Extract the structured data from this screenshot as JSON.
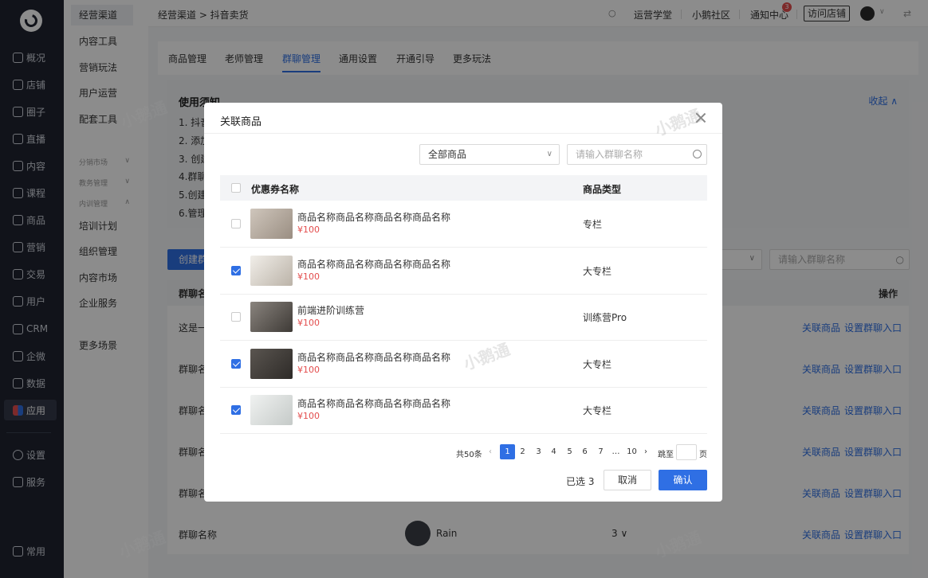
{
  "nav": {
    "items": [
      {
        "label": "概况",
        "icon": "chart-icon"
      },
      {
        "label": "店铺",
        "icon": "store-icon"
      },
      {
        "label": "圈子",
        "icon": "circle-icon"
      },
      {
        "label": "直播",
        "icon": "live-icon"
      },
      {
        "label": "内容",
        "icon": "content-icon"
      },
      {
        "label": "课程",
        "icon": "course-icon"
      },
      {
        "label": "商品",
        "icon": "goods-icon"
      },
      {
        "label": "营销",
        "icon": "marketing-icon"
      },
      {
        "label": "交易",
        "icon": "trade-icon"
      },
      {
        "label": "用户",
        "icon": "user-icon"
      },
      {
        "label": "CRM",
        "icon": "crm-icon"
      },
      {
        "label": "企微",
        "icon": "wecom-icon"
      },
      {
        "label": "数据",
        "icon": "data-icon"
      },
      {
        "label": "应用",
        "icon": "apps-icon"
      }
    ],
    "settings": "设置",
    "service": "服务",
    "common": "常用"
  },
  "side": {
    "items": [
      "经营渠道",
      "内容工具",
      "营销玩法",
      "用户运营",
      "配套工具"
    ],
    "groups": [
      "分销市场",
      "教务管理",
      "内训管理"
    ],
    "sub": [
      "培训计划",
      "组织管理",
      "内容市场",
      "企业服务"
    ],
    "more": "更多场景"
  },
  "topbar": {
    "breadcrumb": "经营渠道 > 抖音卖货",
    "links": [
      "运营学堂",
      "小鹅社区",
      "通知中心"
    ],
    "badge": "3",
    "visit": "访问店铺"
  },
  "tabs": [
    "商品管理",
    "老师管理",
    "群聊管理",
    "通用设置",
    "开通引导",
    "更多玩法"
  ],
  "notice": {
    "title": "使用须知",
    "fold": "收起",
    "lines": [
      "1. 抖音",
      "2. 添加",
      "3. 创建",
      "4.群聊",
      "5.创建",
      "6.管理"
    ]
  },
  "list": {
    "create": "创建群",
    "search_placeholder": "请输入群聊名称",
    "head_name": "群聊名",
    "head_op": "操作",
    "rows": [
      "这是一",
      "群聊名",
      "群聊名",
      "群聊名",
      "群聊名",
      "群聊名称"
    ],
    "link_goods": "关联商品",
    "link_entry": "设置群聊入口",
    "rain": "Rain",
    "rain_count": "3"
  },
  "modal": {
    "title": "关联商品",
    "select": "全部商品",
    "search_placeholder": "请输入群聊名称",
    "col_name": "优惠券名称",
    "col_type": "商品类型",
    "rows": [
      {
        "name": "商品名称商品名称商品名称商品名称",
        "price": "¥100",
        "type": "专栏",
        "checked": false,
        "thumb": "#b9aca0"
      },
      {
        "name": "商品名称商品名称商品名称商品名称",
        "price": "¥100",
        "type": "大专栏",
        "checked": true,
        "thumb": "#d8d2c8"
      },
      {
        "name": "前端进阶训练营",
        "price": "¥100",
        "type": "训练营Pro",
        "checked": false,
        "thumb": "#6a6560"
      },
      {
        "name": "商品名称商品名称商品名称商品名称",
        "price": "¥100",
        "type": "大专栏",
        "checked": true,
        "thumb": "#4e4a46"
      },
      {
        "name": "商品名称商品名称商品名称商品名称",
        "price": "¥100",
        "type": "大专栏",
        "checked": true,
        "thumb": "#dfe2e0"
      }
    ],
    "total": "共50条",
    "pages": [
      "1",
      "2",
      "3",
      "4",
      "5",
      "6",
      "7",
      "…",
      "10"
    ],
    "jump_label": "跳至",
    "page_unit": "页",
    "selected": "已选 3",
    "cancel": "取消",
    "ok": "确认"
  },
  "watermark": "小鹅通",
  "colors": {
    "primary": "#2f6fe4",
    "price": "#e34d4d",
    "nav": "#1f2430"
  }
}
